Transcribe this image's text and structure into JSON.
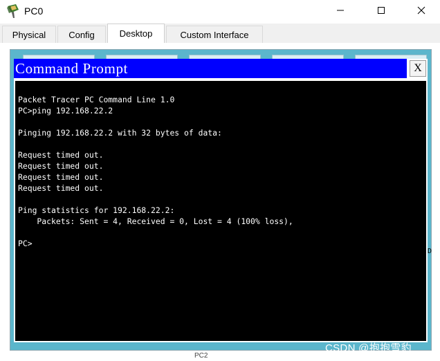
{
  "window": {
    "title": "PC0",
    "minimize_glyph": "—",
    "maximize_glyph": "☐",
    "close_glyph": "✕"
  },
  "tabs": [
    {
      "label": "Physical"
    },
    {
      "label": "Config"
    },
    {
      "label": "Desktop"
    },
    {
      "label": "Custom Interface"
    }
  ],
  "active_tab": "Desktop",
  "command_prompt": {
    "title": "Command Prompt",
    "close_label": "X",
    "lines": [
      "Packet Tracer PC Command Line 1.0",
      "PC>ping 192.168.22.2",
      "",
      "Pinging 192.168.22.2 with 32 bytes of data:",
      "",
      "Request timed out.",
      "Request timed out.",
      "Request timed out.",
      "Request timed out.",
      "",
      "Ping statistics for 192.168.22.2:",
      "    Packets: Sent = 4, Received = 0, Lost = 4 (100% loss),",
      "",
      "PC>"
    ]
  },
  "background": {
    "side_mark": "D",
    "bottom_label": "PC2"
  },
  "watermark": "CSDN @抱抱雪豹",
  "colors": {
    "cmd_titlebar": "#0000ff",
    "terminal_bg": "#000000",
    "terminal_text": "#ffffff",
    "desktop_frame": "#5bb6cc"
  },
  "icons": [
    "packet-tracer-pc-icon",
    "minimize-icon",
    "maximize-icon",
    "close-icon"
  ]
}
